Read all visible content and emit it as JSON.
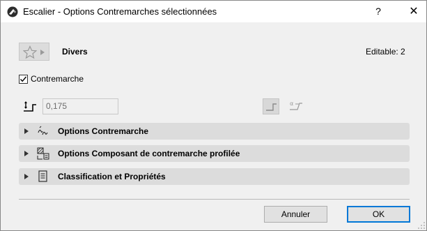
{
  "window": {
    "title": "Escalier - Options Contremarches sélectionnées",
    "help_label": "?",
    "close_label": "✕"
  },
  "header": {
    "favorites_icon": "star-icon",
    "section_name": "Divers",
    "editable_label": "Editable: 2"
  },
  "riser_checkbox": {
    "label": "Contremarche",
    "checked": true
  },
  "riser_height": {
    "value": "0,175"
  },
  "sections": [
    {
      "label": "Options Contremarche",
      "icon": "riser-options-icon"
    },
    {
      "label": "Options Composant de contremarche profilée",
      "icon": "profile-component-icon"
    },
    {
      "label": "Classification et Propriétés",
      "icon": "properties-icon"
    }
  ],
  "footer": {
    "cancel_label": "Annuler",
    "ok_label": "OK"
  },
  "colors": {
    "ok_border": "#0078d7",
    "section_bg": "#dcdcdc"
  }
}
